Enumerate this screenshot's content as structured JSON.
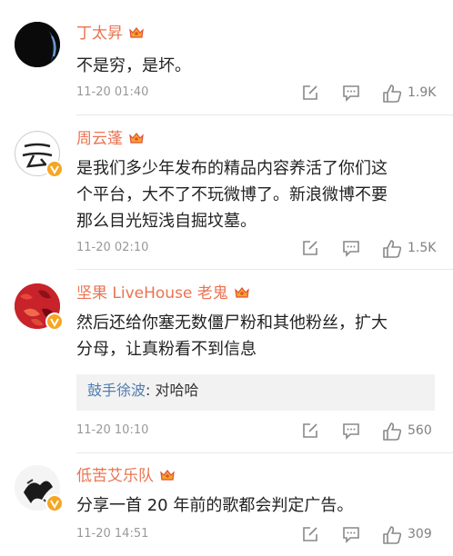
{
  "colors": {
    "username": "#eb7350",
    "reply_name": "#507daf",
    "meta": "#999999",
    "vip_badge": "#f5a623"
  },
  "comments": [
    {
      "username": "丁太昇",
      "text": "不是穷，是坏。",
      "time": "11-20 01:40",
      "likes": "1.9K",
      "avatar_icon": "dark-globe-avatar"
    },
    {
      "username": "周云蓬",
      "text_lines": [
        "是我们多少年发布的精品内容养活了你们这",
        "个平台，大不了不玩微博了。新浪微博不要",
        "那么目光短浅自掘坟墓。"
      ],
      "time": "11-20 02:10",
      "likes": "1.5K",
      "avatar_icon": "calligraphy-avatar"
    },
    {
      "username": "坚果 LiveHouse 老鬼",
      "text_lines": [
        "然后还给你塞无数僵尸粉和其他粉丝，扩大",
        "分母，让真粉看不到信息"
      ],
      "reply": {
        "name": "鼓手徐波",
        "text": ": 对哈哈"
      },
      "time": "11-20 10:10",
      "likes": "560",
      "avatar_icon": "red-pattern-avatar"
    },
    {
      "username": "低苦艾乐队",
      "text": "分享一首 20 年前的歌都会判定广告。",
      "time": "11-20 14:51",
      "likes": "309",
      "avatar_icon": "ink-figure-avatar"
    }
  ]
}
